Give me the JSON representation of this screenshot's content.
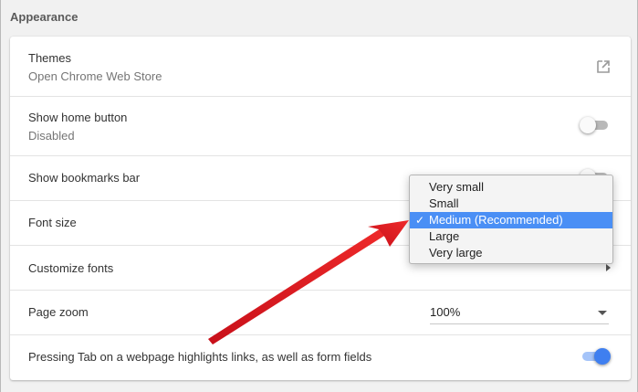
{
  "section": {
    "title": "Appearance"
  },
  "settings": {
    "themes": {
      "label": "Themes",
      "sublabel": "Open Chrome Web Store"
    },
    "home_button": {
      "label": "Show home button",
      "sublabel": "Disabled",
      "enabled": false
    },
    "bookmarks_bar": {
      "label": "Show bookmarks bar",
      "enabled": false
    },
    "font_size": {
      "label": "Font size"
    },
    "customize_fonts": {
      "label": "Customize fonts"
    },
    "page_zoom": {
      "label": "Page zoom",
      "value": "100%"
    },
    "tab_highlight": {
      "label": "Pressing Tab on a webpage highlights links, as well as form fields",
      "enabled": true
    }
  },
  "font_size_menu": {
    "items": [
      {
        "label": "Very small"
      },
      {
        "label": "Small"
      },
      {
        "label": "Medium (Recommended)",
        "selected": true,
        "check": "✓"
      },
      {
        "label": "Large"
      },
      {
        "label": "Very large"
      }
    ]
  },
  "colors": {
    "accent": "#3f7ff0",
    "selection": "#4a8ff5",
    "annotation_arrow": "#e0141a"
  }
}
